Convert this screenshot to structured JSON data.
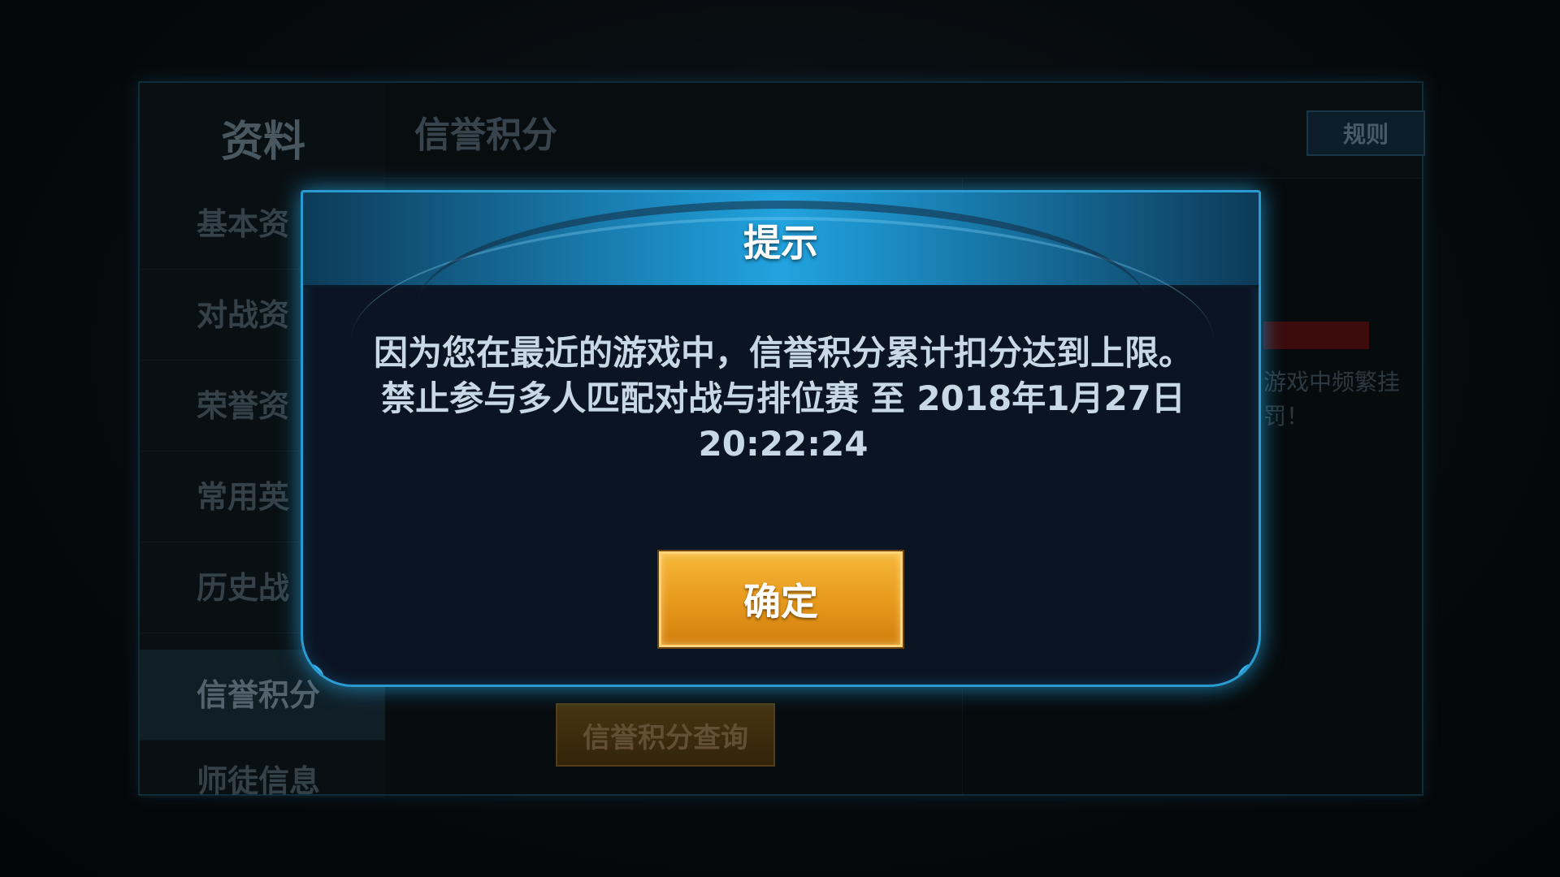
{
  "background_panel": {
    "title": "资料",
    "section_title": "信誉积分",
    "rule_button_label": "规则",
    "nav_items": [
      {
        "label": "基本资",
        "active": false
      },
      {
        "label": "对战资",
        "active": false
      },
      {
        "label": "荣誉资",
        "active": false
      },
      {
        "label": "常用英",
        "active": false
      },
      {
        "label": "历史战",
        "active": false
      },
      {
        "label": "信誉积分",
        "active": true
      },
      {
        "label": "师徒信息",
        "active": false
      }
    ],
    "note_text": "游戏中频繁挂\n罚！",
    "query_button_label": "信誉积分查询"
  },
  "modal": {
    "title": "提示",
    "message_line1": "因为您在最近的游戏中，信誉积分累计扣分达到上限。",
    "message_line2": "禁止参与多人匹配对战与排位赛 至 2018年1月27日",
    "message_line3": "20:22:24",
    "confirm_label": "确定"
  },
  "colors": {
    "modal_border": "#2a9bd1",
    "header_accent": "#22a3df",
    "confirm_button": "#e89b1d"
  },
  "icons": {
    "close": "close-x-icon"
  }
}
